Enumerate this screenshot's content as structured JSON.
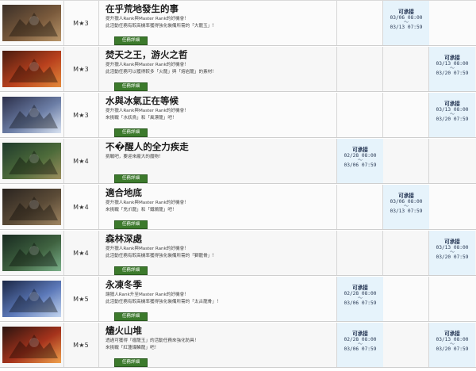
{
  "button_label": "任務詳細",
  "quests": [
    {
      "rank": "M★3",
      "title": "在乎荒地發生的事",
      "desc1": "提升獵人Rank與Master Rank的好機會！",
      "desc2": "此活動任務有較高機率獲得強化裝備所需的「大龍玉」！",
      "start": "03/06 08:00",
      "end": "03/13 07:59"
    },
    {
      "rank": "M★3",
      "title": "焚天之王，游火之哲",
      "desc1": "提升獵人Rank與Master Rank的好機會！",
      "desc2": "此活動任務可以獲得較多「火龍」與「熔岩龍」的素材！",
      "start": "03/13 08:00",
      "end": "03/20 07:59"
    },
    {
      "rank": "M★3",
      "title": "水與冰氣正在等候",
      "desc1": "提升獵人Rank與Master Rank的好機會！",
      "desc2": "來挑戰「水妖鳥」和「風漂龍」吧！",
      "start": "03/13 08:00",
      "end": "03/20 07:59"
    },
    {
      "rank": "M★4",
      "title": "不�醒人的全力疾走",
      "desc1": "挑戰吧，要迎來龐大的魔物！",
      "desc2": "",
      "start": "02/28 08:00",
      "end": "03/06 07:59"
    },
    {
      "rank": "M★4",
      "title": "適合地底",
      "desc1": "提升獵人Rank與Master Rank的好機會！",
      "desc2": "來挑戰「兇爪龍」和「鐵鴉龍」吧！",
      "start": "03/06 08:00",
      "end": "03/13 07:59"
    },
    {
      "rank": "M★4",
      "title": "森林深處",
      "desc1": "提升獵人Rank與Master Rank的好機會！",
      "desc2": "此活動任務有較高機率獲得強化裝備所需的「獅龍骨」！",
      "start": "03/13 08:00",
      "end": "03/20 07:59"
    },
    {
      "rank": "M★5",
      "title": "永凍冬季",
      "desc1": "讓獵人Rank升至Master Rank的好機會！",
      "desc2": "此活動任務有較高機率獲得強化裝備所需的「太古龍骨」！",
      "start": "02/28 08:00",
      "end": "03/06 07:59"
    },
    {
      "rank": "M★5",
      "title": "燼火山堆",
      "desc1": "透過可獲得「瘤龍玉」的活動任務來強化防具！",
      "desc2": "來挑戰「紅蓮爆鱗龍」吧！",
      "start1": "02/28 08:00",
      "end1": "03/06 07:59",
      "start": "03/13 08:00",
      "end": "03/20 07:59"
    }
  ],
  "avail_label": "可承接",
  "tilde": "〜",
  "colors": {
    "active_cell": "#e6f3fb",
    "button_green": "#3c7a2c",
    "title_dark": "#1d1d1d"
  }
}
